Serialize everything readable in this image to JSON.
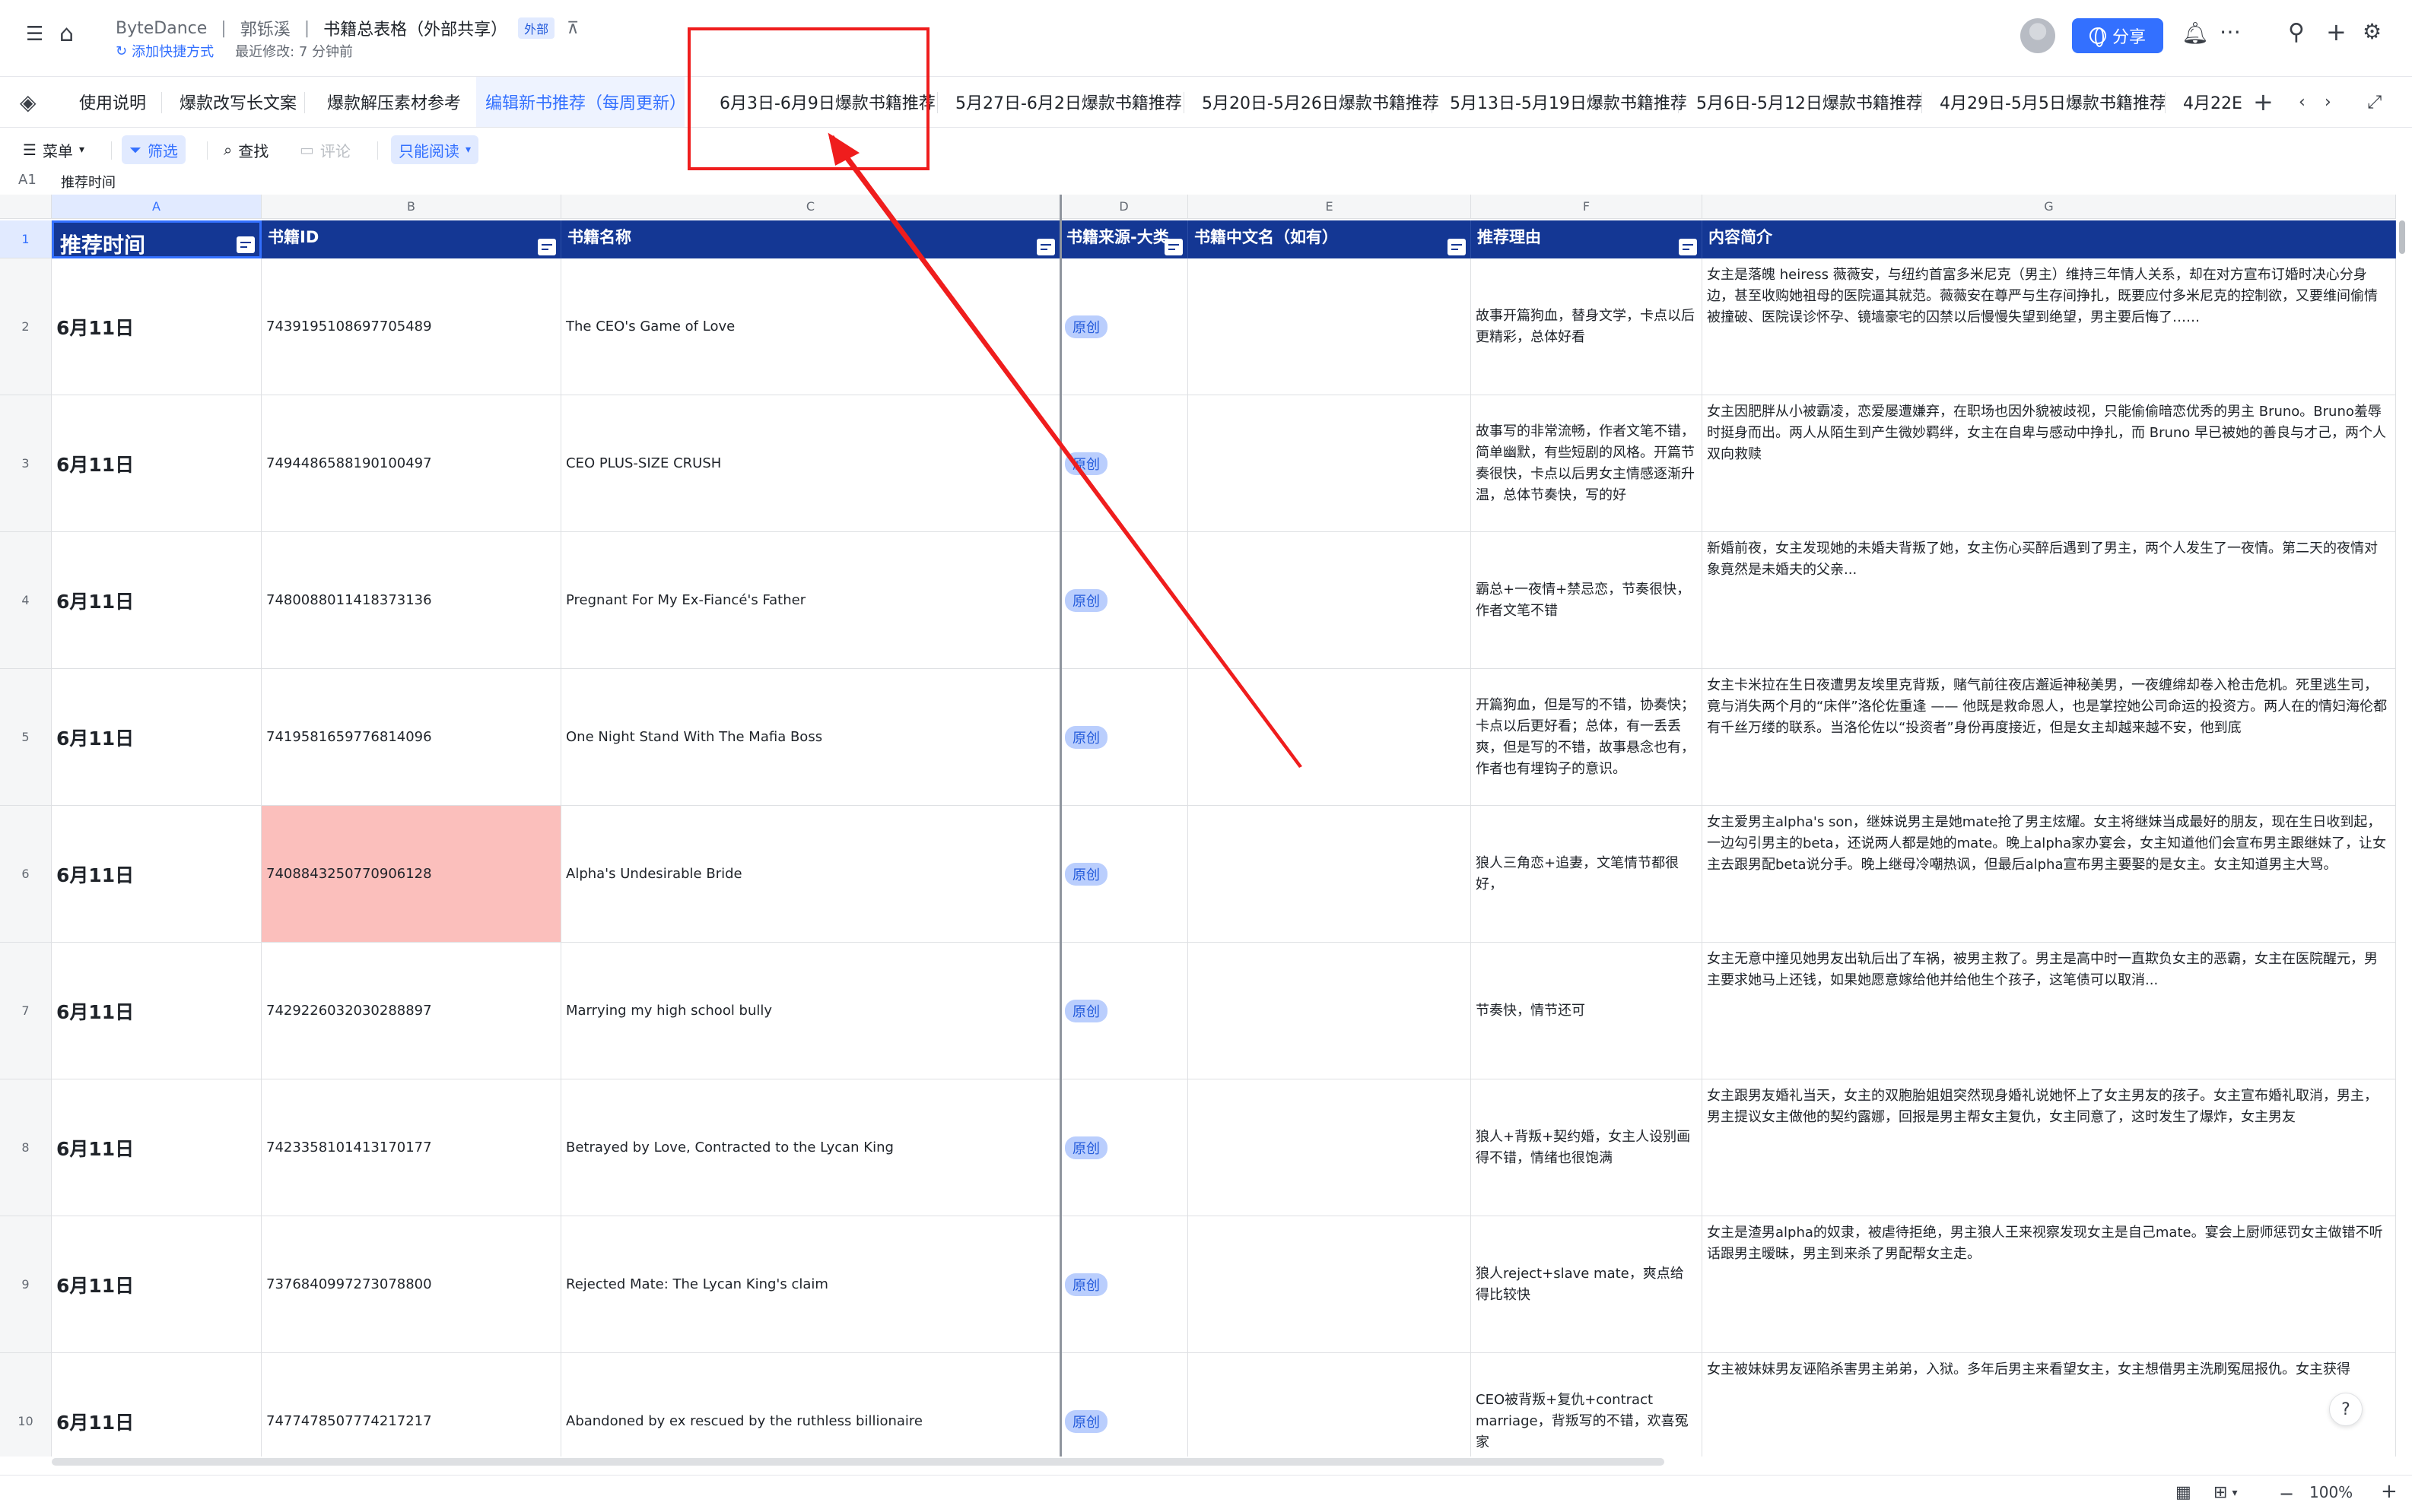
{
  "header": {
    "breadcrumbs": [
      "ByteDance",
      "郭铄溪",
      "书籍总表格（外部共享）"
    ],
    "external_badge": "外部",
    "add_shortcut": "添加快捷方式",
    "last_modified": "最近修改: 7 分钟前",
    "share_label": "分享"
  },
  "tabs": [
    "使用说明",
    "爆款改写长文案",
    "爆款解压素材参考",
    "编辑新书推荐（每周更新）",
    "6月3日-6月9日爆款书籍推荐",
    "5月27日-6月2日爆款书籍推荐",
    "5月20日-5月26日爆款书籍推荐",
    "5月13日-5月19日爆款书籍推荐",
    "5月6日-5月12日爆款书籍推荐",
    "4月29日-5月5日爆款书籍推荐",
    "4月22E"
  ],
  "active_tab_index": 3,
  "toolbar": {
    "menu": "菜单",
    "filter": "筛选",
    "find": "查找",
    "comment": "评论",
    "readonly": "只能阅读"
  },
  "formula_bar": {
    "ref": "A1",
    "value": "推荐时间"
  },
  "columns": [
    "A",
    "B",
    "C",
    "D",
    "E",
    "F",
    "G"
  ],
  "table": {
    "headers": [
      "推荐时间",
      "书籍ID",
      "书籍名称",
      "书籍来源-大类",
      "书籍中文名（如有）",
      "推荐理由",
      "内容简介"
    ],
    "rows": [
      {
        "num": "2",
        "date": "6月11日",
        "id": "7439195108697705489",
        "name": "The CEO's Game of Love",
        "source": "原创",
        "cn": "",
        "reason": "故事开篇狗血，替身文学，卡点以后更精彩，总体好看",
        "summary": "女主是落魄 heiress 薇薇安，与纽约首富多米尼克（男主）维持三年情人关系，却在对方宣布订婚时决心分身边，甚至收购她祖母的医院逼其就范。薇薇安在尊严与生存间挣扎，既要应付多米尼克的控制欲，又要维间偷情被撞破、医院误诊怀孕、镜墙豪宅的囚禁以后慢慢失望到绝望，男主要后悔了……"
      },
      {
        "num": "3",
        "date": "6月11日",
        "id": "7494486588190100497",
        "name": "CEO PLUS-SIZE CRUSH",
        "source": "原创",
        "cn": "",
        "reason": "故事写的非常流畅，作者文笔不错，简单幽默，有些短剧的风格。开篇节奏很快，卡点以后男女主情感逐渐升温，总体节奏快，写的好",
        "summary": "女主因肥胖从小被霸凌，恋爱屡遭嫌弃，在职场也因外貌被歧视，只能偷偷暗恋优秀的男主 Bruno。Bruno羞辱时挺身而出。两人从陌生到产生微妙羁绊，女主在自卑与感动中挣扎，而 Bruno 早已被她的善良与才己，两个人双向救赎"
      },
      {
        "num": "4",
        "date": "6月11日",
        "id": "7480088011418373136",
        "name": "Pregnant For My Ex-Fiancé's Father",
        "source": "原创",
        "cn": "",
        "reason": "霸总+一夜情+禁忌恋，节奏很快，作者文笔不错",
        "summary": "新婚前夜，女主发现她的未婚夫背叛了她，女主伤心买醉后遇到了男主，两个人发生了一夜情。第二天的夜情对象竟然是未婚夫的父亲..."
      },
      {
        "num": "5",
        "date": "6月11日",
        "id": "7419581659776814096",
        "name": " One Night Stand With The Mafia Boss",
        "source": "原创",
        "cn": "",
        "reason": "开篇狗血，但是写的不错，协奏快；卡点以后更好看；总体，有一丢丢爽，但是写的不错，故事悬念也有，作者也有埋钩子的意识。",
        "summary": "女主卡米拉在生日夜遭男友埃里克背叛，赌气前往夜店邂逅神秘美男，一夜缠绵却卷入枪击危机。死里逃生司，竟与消失两个月的“床伴”洛伦佐重逢 —— 他既是救命恩人，也是掌控她公司命运的投资方。两人在的情妇海伦都有千丝万缕的联系。当洛伦佐以“投资者”身份再度接近，但是女主却越来越不安，他到底"
      },
      {
        "num": "6",
        "date": "6月11日",
        "id": "7408843250770906128",
        "name": "Alpha's Undesirable Bride",
        "source": "原创",
        "cn": "",
        "reason": "狼人三角恋+追妻，文笔情节都很好，",
        "summary": "女主爱男主alpha's son，继妹说男主是她mate抢了男主炫耀。女主将继妹当成最好的朋友，现在生日收到起，一边勾引男主的beta，还说两人都是她的mate。晚上alpha家办宴会，女主知道他们会宣布男主跟继妹了，让女主去跟男配beta说分手。晚上继母冷嘲热讽，但最后alpha宣布男主要娶的是女主。女主知道男主大骂。"
      },
      {
        "num": "7",
        "date": "6月11日",
        "id": "7429226032030288897",
        "name": "Marrying my high school bully",
        "source": "原创",
        "cn": "",
        "reason": "节奏快，情节还可",
        "summary": "女主无意中撞见她男友出轨后出了车祸，被男主救了。男主是高中时一直欺负女主的恶霸，女主在医院醒元，男主要求她马上还钱，如果她愿意嫁给他并给他生个孩子，这笔债可以取消..."
      },
      {
        "num": "8",
        "date": "6月11日",
        "id": "7423358101413170177",
        "name": "Betrayed by Love, Contracted to the Lycan King",
        "source": "原创",
        "cn": "",
        "reason": "狼人+背叛+契约婚，女主人设别画得不错，情绪也很饱满",
        "summary": "女主跟男友婚礼当天，女主的双胞胎姐姐突然现身婚礼说她怀上了女主男友的孩子。女主宣布婚礼取消，男主，男主提议女主做他的契约露娜，回报是男主帮女主复仇，女主同意了，这时发生了爆炸，女主男友"
      },
      {
        "num": "9",
        "date": "6月11日",
        "id": "7376840997273078800",
        "name": "Rejected Mate: The Lycan King's claim",
        "source": "原创",
        "cn": "",
        "reason": "狼人reject+slave mate，爽点给得比较快",
        "summary": "女主是渣男alpha的奴隶，被虐待拒绝，男主狼人王来视察发现女主是自己mate。宴会上厨师惩罚女主做错不听话跟男主暧昧，男主到来杀了男配帮女主走。"
      },
      {
        "num": "10",
        "date": "6月11日",
        "id": "7477478507774217217",
        "name": "Abandoned by ex rescued by the ruthless billionaire",
        "source": "原创",
        "cn": "",
        "reason": "CEO被背叛+复仇+contract marriage，背叛写的不错，欢喜冤家",
        "summary": "女主被妹妹男友诬陷杀害男主弟弟，入狱。多年后男主来看望女主，女主想借男主洗刷冤屈报仇。女主获得"
      }
    ]
  },
  "status": {
    "zoom": "100%"
  },
  "annotation": {
    "box_color": "#ef1d1d"
  }
}
